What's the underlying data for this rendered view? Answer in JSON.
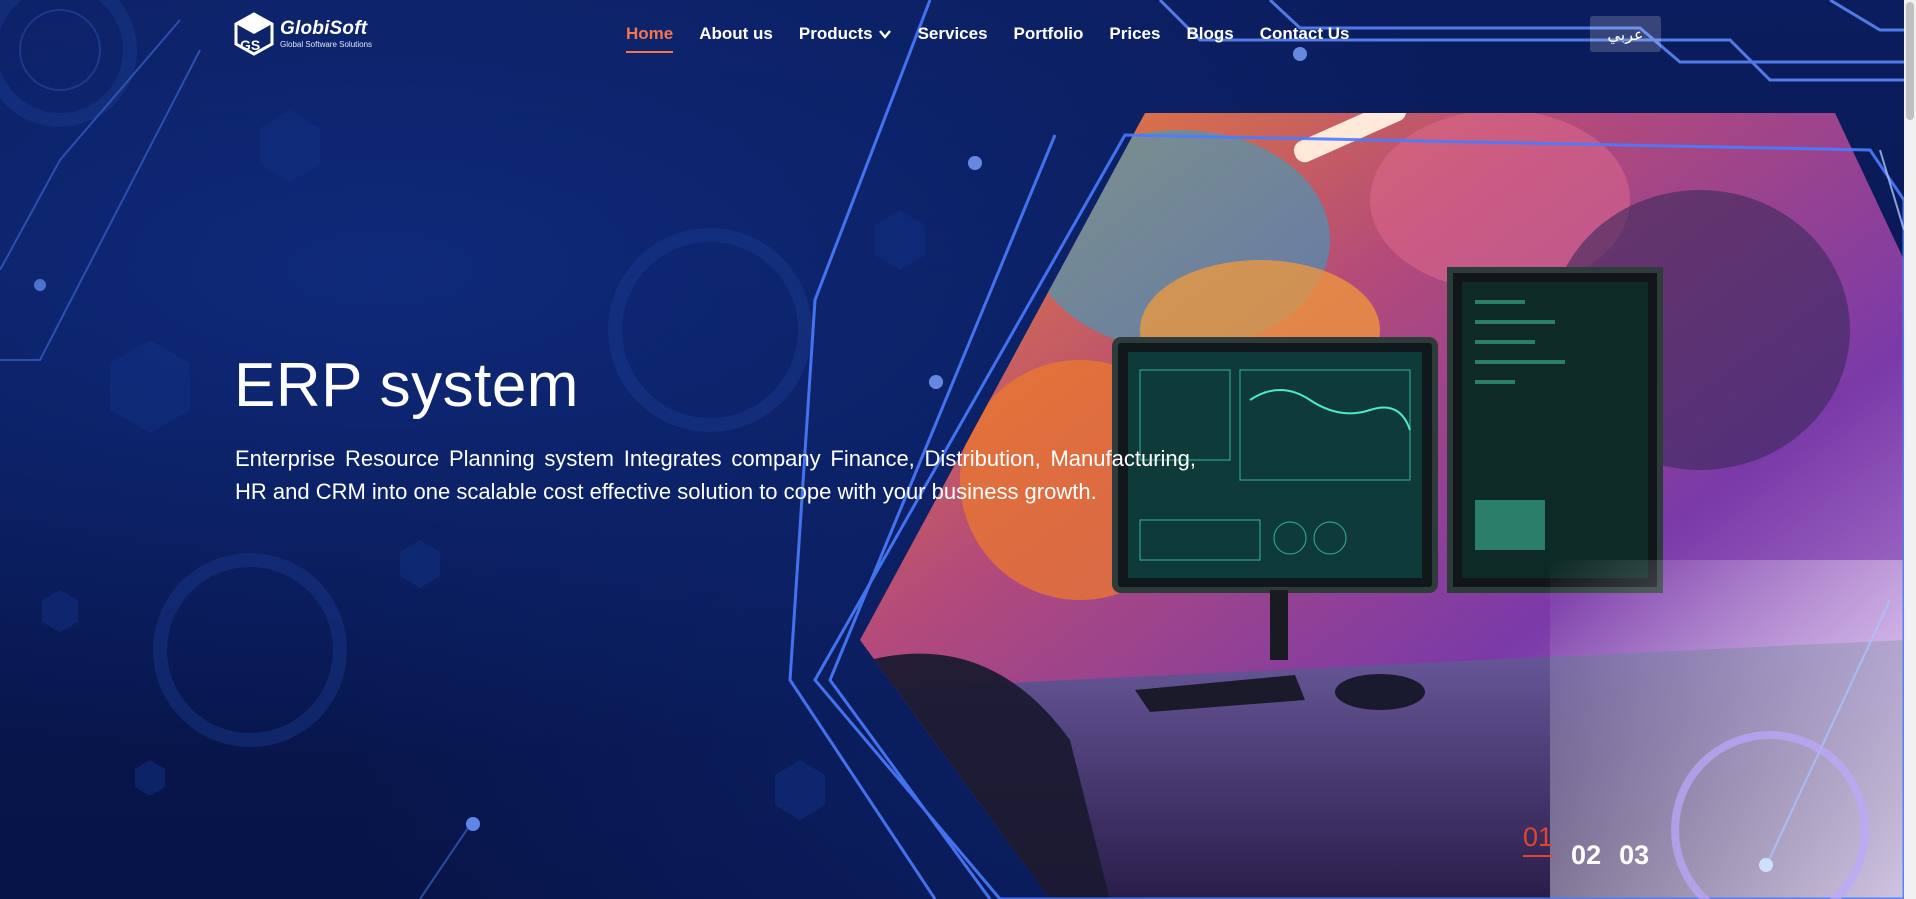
{
  "brand": {
    "name": "GlobiSoft",
    "tagline": "Global Software Solutions",
    "accent": "#f2764f"
  },
  "nav": {
    "items": [
      {
        "label": "Home",
        "active": true
      },
      {
        "label": "About us"
      },
      {
        "label": "Products",
        "has_dropdown": true,
        "icon": "chevron-down-icon"
      },
      {
        "label": "Services"
      },
      {
        "label": "Portfolio"
      },
      {
        "label": "Prices"
      },
      {
        "label": "Blogs"
      },
      {
        "label": "Contact Us"
      }
    ],
    "language_button": "عربي"
  },
  "hero": {
    "title": "ERP system",
    "description": "Enterprise Resource Planning system Integrates company Finance, Distribution, Manufacturing, HR and CRM into one scalable cost effective solution to cope with your business growth.",
    "image": "computer-workstation-photo"
  },
  "slider": {
    "pages": [
      "01",
      "02",
      "03"
    ],
    "active_color": "#e0452f"
  }
}
